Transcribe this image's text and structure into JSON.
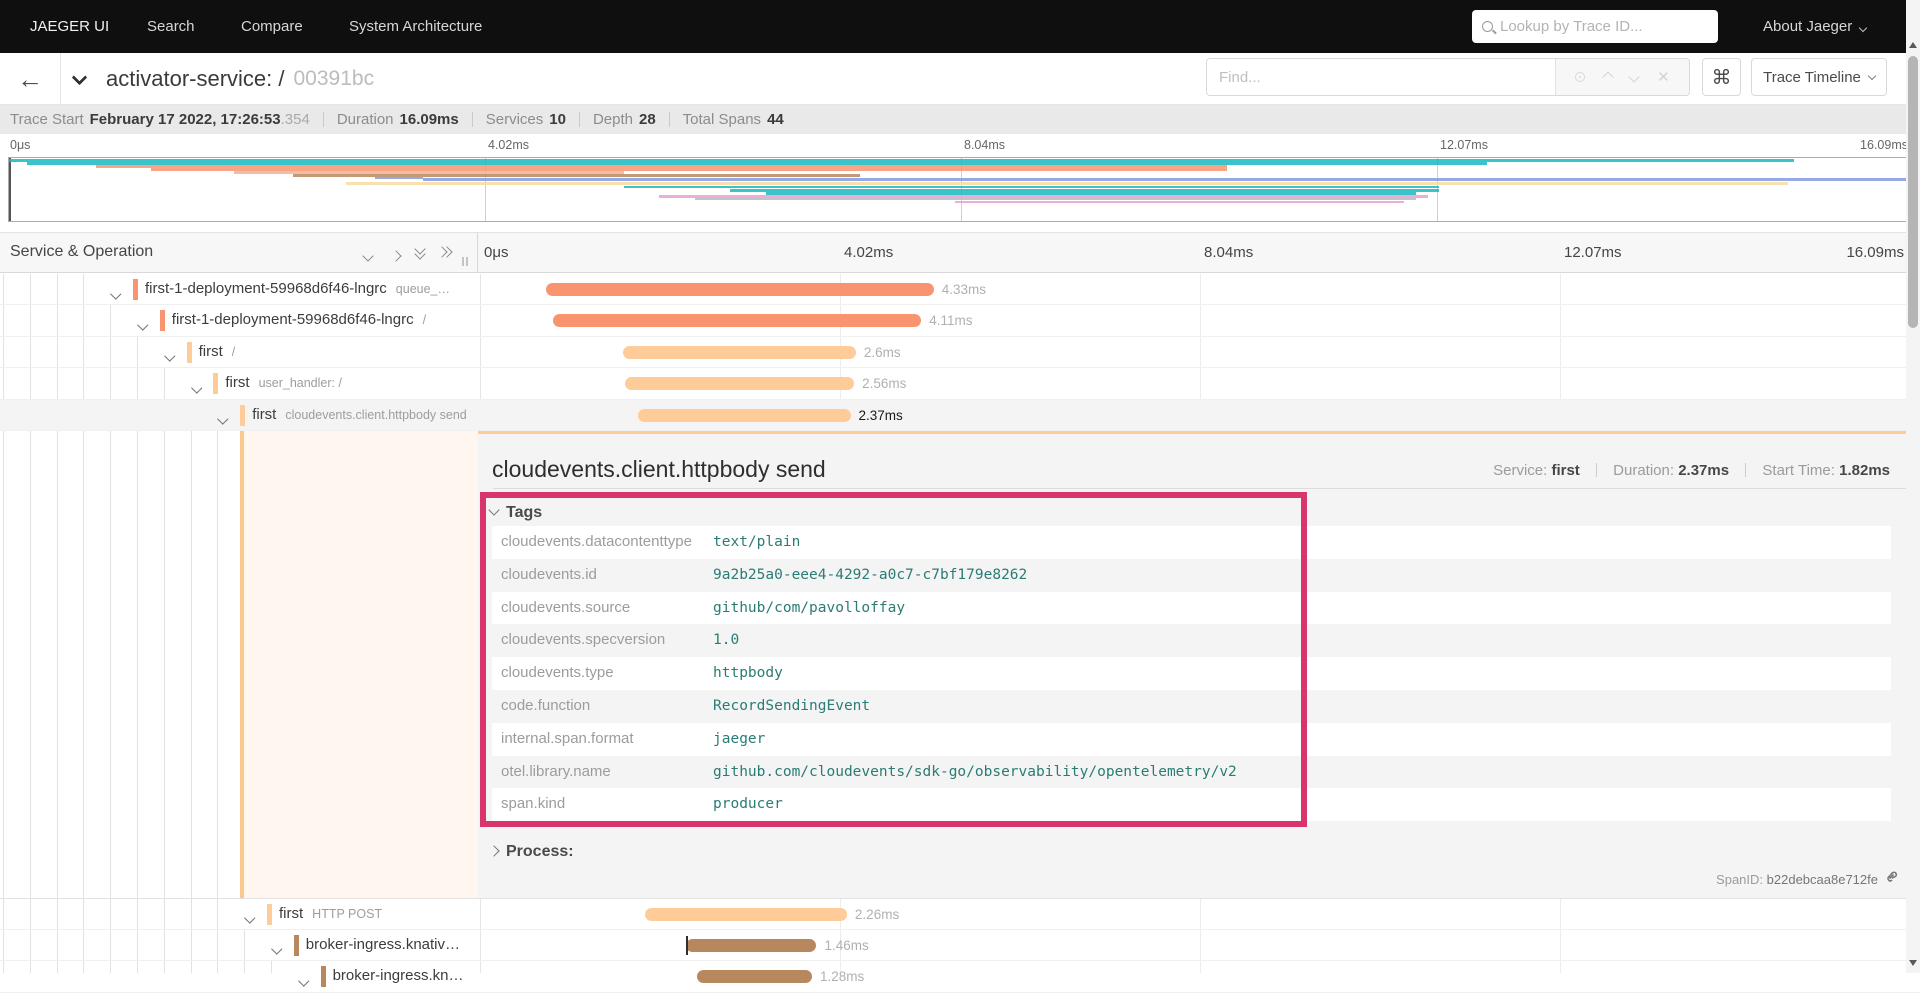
{
  "nav": {
    "brand": "JAEGER UI",
    "items": [
      "Search",
      "Compare",
      "System Architecture"
    ],
    "search_placeholder": "Lookup by Trace ID...",
    "about": "About Jaeger"
  },
  "titlebar": {
    "title": "activator-service: /",
    "trace_id": "00391bc",
    "find_placeholder": "Find...",
    "view_select": "Trace Timeline"
  },
  "infobar": {
    "trace_start_label": "Trace Start",
    "trace_start": "February 17 2022, 17:26:53",
    "trace_start_ms": ".354",
    "duration_label": "Duration",
    "duration": "16.09ms",
    "services_label": "Services",
    "services": "10",
    "depth_label": "Depth",
    "depth": "28",
    "total_spans_label": "Total Spans",
    "total_spans": "44"
  },
  "grid_header": {
    "label": "Service & Operation"
  },
  "chart_data": {
    "type": "gantt-trace-timeline",
    "duration_ms": 16.09,
    "ticks": [
      "0μs",
      "4.02ms",
      "8.04ms",
      "12.07ms",
      "16.09ms"
    ],
    "spans": [
      {
        "service": "first-1-deployment-59968d6f46-lngrc",
        "operation": "queue_…",
        "depth": 4,
        "color": "#F89570",
        "start_ms": 0.74,
        "duration_ms": 4.33,
        "duration_label": "4.33ms",
        "selected": false,
        "log_tick": false
      },
      {
        "service": "first-1-deployment-59968d6f46-lngrc",
        "operation": "/",
        "depth": 5,
        "color": "#F89570",
        "start_ms": 0.82,
        "duration_ms": 4.11,
        "duration_label": "4.11ms",
        "selected": false,
        "log_tick": false
      },
      {
        "service": "first",
        "operation": "/",
        "depth": 6,
        "color": "#FFCB99",
        "start_ms": 1.6,
        "duration_ms": 2.6,
        "duration_label": "2.6ms",
        "selected": false,
        "log_tick": false
      },
      {
        "service": "first",
        "operation": "user_handler: /",
        "depth": 7,
        "color": "#FFCB99",
        "start_ms": 1.62,
        "duration_ms": 2.56,
        "duration_label": "2.56ms",
        "selected": false,
        "log_tick": false
      },
      {
        "service": "first",
        "operation": "cloudevents.client.httpbody send",
        "depth": 8,
        "color": "#FFCB99",
        "start_ms": 1.77,
        "duration_ms": 2.37,
        "duration_label": "2.37ms",
        "selected": true,
        "log_tick": false
      },
      {
        "service": "first",
        "operation": "HTTP POST",
        "depth": 9,
        "color": "#FFCB99",
        "start_ms": 1.84,
        "duration_ms": 2.26,
        "duration_label": "2.26ms",
        "selected": false,
        "log_tick": false
      },
      {
        "service": "broker-ingress.knativ…",
        "operation": "",
        "depth": 10,
        "color": "#B7885E",
        "start_ms": 2.3,
        "duration_ms": 1.46,
        "duration_label": "1.46ms",
        "selected": false,
        "log_tick": true
      },
      {
        "service": "broker-ingress.kn…",
        "operation": "",
        "depth": 11,
        "color": "#B7885E",
        "start_ms": 2.43,
        "duration_ms": 1.28,
        "duration_label": "1.28ms",
        "selected": false,
        "log_tick": false
      }
    ],
    "minimap_lines": [
      {
        "y": 1,
        "h": 2.6,
        "color": "#17B8BE",
        "s": 0.0,
        "e": 15.1
      },
      {
        "y": 4,
        "h": 2.6,
        "color": "#17B8BE",
        "s": 0.15,
        "e": 12.5
      },
      {
        "y": 7,
        "h": 2.6,
        "color": "#F89570",
        "s": 0.74,
        "e": 10.3
      },
      {
        "y": 10,
        "h": 2.6,
        "color": "#F89570",
        "s": 1.2,
        "e": 10.3
      },
      {
        "y": 13,
        "h": 2.6,
        "color": "#F2B091",
        "s": 1.9,
        "e": 5.2
      },
      {
        "y": 16,
        "h": 2.6,
        "color": "#B7885E",
        "s": 2.4,
        "e": 7.2
      },
      {
        "y": 19,
        "h": 2,
        "color": "#829AE3",
        "s": 3.1,
        "e": 3.5
      },
      {
        "y": 20,
        "h": 2.8,
        "color": "#829AE3",
        "s": 3.5,
        "e": 16.09
      },
      {
        "y": 24,
        "h": 3,
        "color": "#F8DCA1",
        "s": 2.85,
        "e": 15.05
      },
      {
        "y": 27.5,
        "h": 2.6,
        "color": "#17B8BE",
        "s": 5.2,
        "e": 12.1
      },
      {
        "y": 30.5,
        "h": 3,
        "color": "#17B8BE",
        "s": 6.1,
        "e": 12.1
      },
      {
        "y": 34,
        "h": 2.6,
        "color": "#17B8BE",
        "s": 6.4,
        "e": 11.9
      },
      {
        "y": 37,
        "h": 2.6,
        "color": "#E79FD5",
        "s": 5.5,
        "e": 12.0
      },
      {
        "y": 40,
        "h": 2.2,
        "color": "#b8b8b8",
        "s": 5.8,
        "e": 11.9
      },
      {
        "y": 42.5,
        "h": 2.6,
        "color": "#E79FD5",
        "s": 8.0,
        "e": 11.8
      }
    ]
  },
  "detail": {
    "title": "cloudevents.client.httpbody send",
    "service_label": "Service:",
    "service": "first",
    "duration_label": "Duration:",
    "duration": "2.37ms",
    "start_label": "Start Time:",
    "start": "1.82ms",
    "tags_label": "Tags",
    "tags": [
      {
        "key": "cloudevents.datacontenttype",
        "value": "text/plain"
      },
      {
        "key": "cloudevents.id",
        "value": "9a2b25a0-eee4-4292-a0c7-c7bf179e8262"
      },
      {
        "key": "cloudevents.source",
        "value": "github/com/pavolloffay"
      },
      {
        "key": "cloudevents.specversion",
        "value": "1.0"
      },
      {
        "key": "cloudevents.type",
        "value": "httpbody"
      },
      {
        "key": "code.function",
        "value": "RecordSendingEvent"
      },
      {
        "key": "internal.span.format",
        "value": "jaeger"
      },
      {
        "key": "otel.library.name",
        "value": "github.com/cloudevents/sdk-go/observability/opentelemetry/v2"
      },
      {
        "key": "span.kind",
        "value": "producer"
      }
    ],
    "process_label": "Process:",
    "span_id_label": "SpanID:",
    "span_id": "b22debcaa8e712fe"
  },
  "colors": {
    "accent_selected_span": "#FFCB99",
    "annotation_box": "#d8356f",
    "tag_value": "#2a7c74"
  }
}
